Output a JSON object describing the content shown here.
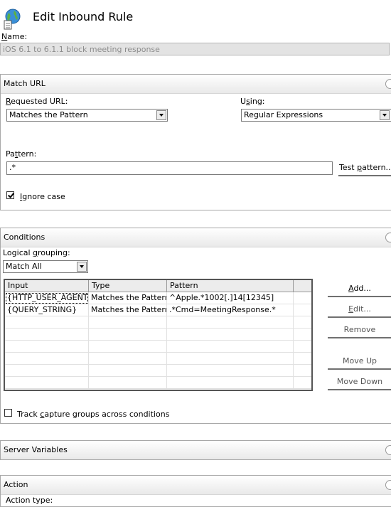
{
  "header": {
    "title": "Edit Inbound Rule",
    "icon": "globe-document-icon"
  },
  "name": {
    "label_underlined": "N",
    "label_rest": "ame:",
    "value": "iOS 6.1 to 6.1.1 block meeting response"
  },
  "match_url": {
    "section_title": "Match URL",
    "requested_url": {
      "label_underlined": "R",
      "label_rest": "equested URL:",
      "value": "Matches the Pattern"
    },
    "using": {
      "label_pre": "U",
      "label_underlined": "s",
      "label_rest": "ing:",
      "value": "Regular Expressions"
    },
    "pattern": {
      "label_pre": "Pa",
      "label_underlined": "t",
      "label_rest": "tern:",
      "value": ".*"
    },
    "test_pattern_button": {
      "pre": "Test ",
      "underlined": "p",
      "rest": "attern..."
    },
    "ignore_case": {
      "underlined": "I",
      "rest": "gnore case",
      "checked": true
    }
  },
  "conditions": {
    "section_title": "Conditions",
    "logical_grouping": {
      "label_pre": "Logical ",
      "label_underlined": "g",
      "label_rest": "rouping:",
      "value": "Match All"
    },
    "columns": [
      "Input",
      "Type",
      "Pattern"
    ],
    "rows": [
      [
        "{HTTP_USER_AGENT}",
        "Matches the Pattern",
        "^Apple.*1002[.]14[12345]"
      ],
      [
        "{QUERY_STRING}",
        "Matches the Pattern",
        ".*Cmd=MeetingResponse.*"
      ]
    ],
    "buttons": {
      "add": {
        "underlined": "A",
        "rest": "dd..."
      },
      "edit": {
        "underlined": "E",
        "rest": "dit..."
      },
      "remove": "Remove",
      "move_up": "Move Up",
      "move_down": "Move Down"
    },
    "track_capture": {
      "pre": "Track ",
      "underlined": "c",
      "rest": "apture groups across conditions",
      "checked": false
    }
  },
  "server_variables": {
    "section_title": "Server Variables"
  },
  "action": {
    "section_title": "Action",
    "action_type_label": "Action type:"
  }
}
